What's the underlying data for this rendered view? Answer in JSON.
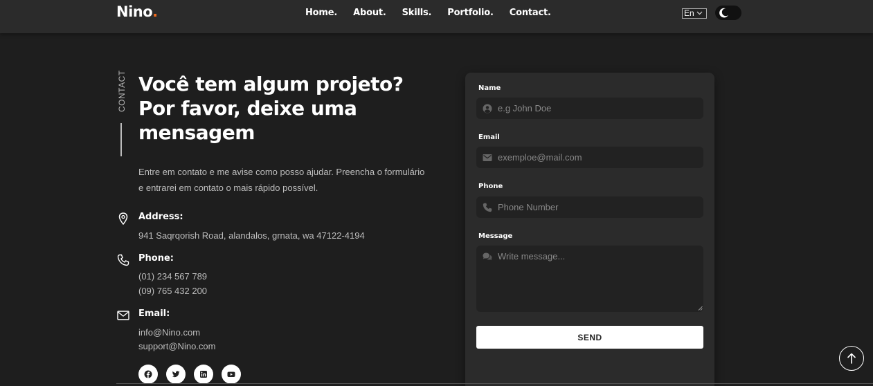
{
  "header": {
    "logo_text": "Nino",
    "logo_dot": ".",
    "nav": [
      "Home.",
      "About.",
      "Skills.",
      "Portfolio.",
      "Contact."
    ],
    "language": "En",
    "theme_toggle": "dark"
  },
  "contact": {
    "side_label": "CONTACT",
    "title": "Você tem algum projeto? Por favor, deixe uma mensagem",
    "description": "Entre em contato e me avise como posso ajudar. Preencha o formulário e entrarei em contato o mais rápido possível.",
    "address": {
      "title": "Address:",
      "lines": [
        "941 Saqrqorish Road, alandalos, grnata, wa 47122-4194"
      ]
    },
    "phone": {
      "title": "Phone:",
      "lines": [
        "(01) 234 567 789",
        "(09) 765 432 200"
      ]
    },
    "email": {
      "title": "Email:",
      "lines": [
        "info@Nino.com",
        "support@Nino.com"
      ]
    },
    "social": [
      "facebook-icon",
      "twitter-icon",
      "linkedin-icon",
      "youtube-icon"
    ]
  },
  "form": {
    "name": {
      "label": "Name",
      "placeholder": "e.g John Doe",
      "value": ""
    },
    "email": {
      "label": "Email",
      "placeholder": "exemploe@mail.com",
      "value": ""
    },
    "phone": {
      "label": "Phone",
      "placeholder": "Phone Number",
      "value": ""
    },
    "message": {
      "label": "Message",
      "placeholder": "Write message...",
      "value": ""
    },
    "submit": "SEND"
  },
  "colors": {
    "accent": "#f26b1d",
    "background": "#1e1e1e",
    "card": "#2b2b2b"
  }
}
